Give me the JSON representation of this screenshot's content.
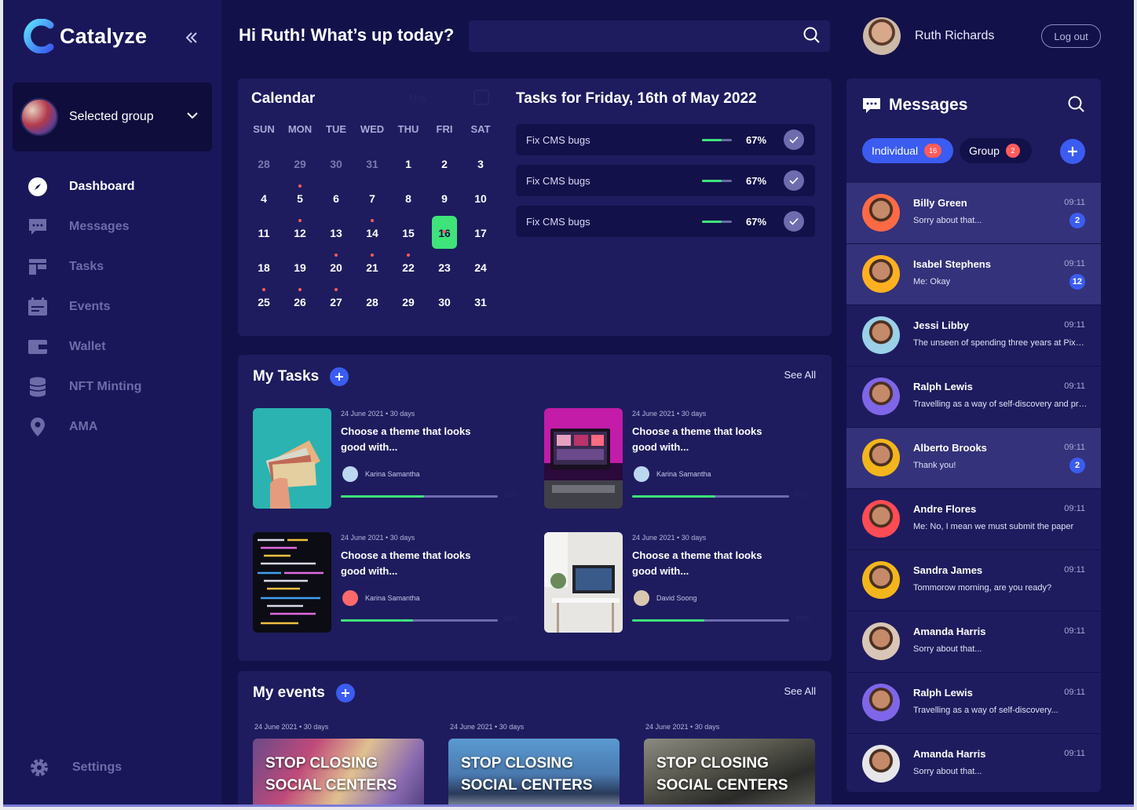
{
  "app": {
    "name": "Catalyze"
  },
  "sidebar": {
    "group_label": "Selected group",
    "items": [
      {
        "label": "Dashboard",
        "icon": "compass-icon",
        "active": true
      },
      {
        "label": "Messages",
        "icon": "chat-icon",
        "active": false
      },
      {
        "label": "Tasks",
        "icon": "tasks-icon",
        "active": false
      },
      {
        "label": "Events",
        "icon": "events-icon",
        "active": false
      },
      {
        "label": "Wallet",
        "icon": "wallet-icon",
        "active": false
      },
      {
        "label": "NFT Minting",
        "icon": "coins-icon",
        "active": false
      },
      {
        "label": "AMA",
        "icon": "location-icon",
        "active": false
      }
    ],
    "settings_label": "Settings"
  },
  "header": {
    "greeting": "Hi Ruth! What’s up today?",
    "search_placeholder": "",
    "user_name": "Ruth Richards",
    "logout_label": "Log out"
  },
  "calendar": {
    "title": "Calendar",
    "month": "May",
    "weekdays": [
      "SUN",
      "MON",
      "TUE",
      "WED",
      "THU",
      "FRI",
      "SAT"
    ],
    "weeks": [
      [
        {
          "d": "28",
          "m": true
        },
        {
          "d": "29",
          "m": true
        },
        {
          "d": "30",
          "m": true
        },
        {
          "d": "31",
          "m": true
        },
        {
          "d": "1"
        },
        {
          "d": "2"
        },
        {
          "d": "3"
        }
      ],
      [
        {
          "d": "4"
        },
        {
          "d": "5",
          "dot": true
        },
        {
          "d": "6"
        },
        {
          "d": "7"
        },
        {
          "d": "8"
        },
        {
          "d": "9"
        },
        {
          "d": "10"
        }
      ],
      [
        {
          "d": "11"
        },
        {
          "d": "12",
          "dot": true
        },
        {
          "d": "13"
        },
        {
          "d": "14",
          "dot": true
        },
        {
          "d": "15"
        },
        {
          "d": "16",
          "today": true,
          "dot": true
        },
        {
          "d": "17"
        }
      ],
      [
        {
          "d": "18"
        },
        {
          "d": "19"
        },
        {
          "d": "20",
          "dot": true
        },
        {
          "d": "21",
          "dot": true
        },
        {
          "d": "22",
          "dot": true
        },
        {
          "d": "23"
        },
        {
          "d": "24"
        }
      ],
      [
        {
          "d": "25",
          "dot": true
        },
        {
          "d": "26",
          "dot": true
        },
        {
          "d": "27",
          "dot": true
        },
        {
          "d": "28"
        },
        {
          "d": "29"
        },
        {
          "d": "30"
        },
        {
          "d": "31"
        }
      ]
    ]
  },
  "daily_tasks": {
    "title": "Tasks for Friday, 16th of May 2022",
    "items": [
      {
        "name": "Fix CMS bugs",
        "percent": "67%",
        "progress": 0.67
      },
      {
        "name": "Fix CMS bugs",
        "percent": "67%",
        "progress": 0.67
      },
      {
        "name": "Fix CMS bugs",
        "percent": "67%",
        "progress": 0.67
      }
    ]
  },
  "my_tasks": {
    "title": "My Tasks",
    "see_all": "See All",
    "items": [
      {
        "meta": "24 June 2021 • 30 days",
        "title": "Choose a theme that looks good with...",
        "assignee": "Karina Samantha",
        "progress": 0.53,
        "percent": "53%"
      },
      {
        "meta": "24 June 2021 • 30 days",
        "title": "Choose a theme that looks good with...",
        "assignee": "Karina Samantha",
        "progress": 0.53,
        "percent": "53%"
      },
      {
        "meta": "24 June 2021 • 30 days",
        "title": "Choose a theme that looks good with...",
        "assignee": "Karina Samantha",
        "progress": 0.46,
        "percent": "46%"
      },
      {
        "meta": "24 June 2021 • 30 days",
        "title": "Choose a theme that looks good with...",
        "assignee": "David Soong",
        "progress": 0.46,
        "percent": "46%"
      }
    ]
  },
  "my_events": {
    "title": "My events",
    "see_all": "See All",
    "items": [
      {
        "meta": "24 June 2021 • 30 days",
        "title_line1": "STOP CLOSING",
        "title_line2": "SOCIAL CENTERS"
      },
      {
        "meta": "24 June 2021 • 30 days",
        "title_line1": "STOP CLOSING",
        "title_line2": "SOCIAL CENTERS"
      },
      {
        "meta": "24 June 2021 • 30 days",
        "title_line1": "STOP CLOSING",
        "title_line2": "SOCIAL CENTERS"
      }
    ]
  },
  "messages": {
    "title": "Messages",
    "tabs": [
      {
        "label": "Individual",
        "count": "16"
      },
      {
        "label": "Group",
        "count": "2"
      }
    ],
    "items": [
      {
        "name": "Billy Green",
        "preview": "Sorry about that...",
        "time": "09:11",
        "badge": "2",
        "highlight": true,
        "avatar_bg": "#ff6a45"
      },
      {
        "name": "Isabel Stephens",
        "preview": "Me: Okay",
        "time": "09:11",
        "badge": "12",
        "highlight": true,
        "avatar_bg": "#ffb020"
      },
      {
        "name": "Jessi Libby",
        "preview": "The unseen of spending three years at Pixelgrade",
        "time": "09:11",
        "badge": "",
        "highlight": false,
        "avatar_bg": "#9ad0e8"
      },
      {
        "name": "Ralph Lewis",
        "preview": "Travelling as a way of self-discovery and progress",
        "time": "09:11",
        "badge": "",
        "highlight": false,
        "avatar_bg": "#7f66e8"
      },
      {
        "name": "Alberto Brooks",
        "preview": "Thank you!",
        "time": "09:11",
        "badge": "2",
        "highlight": true,
        "avatar_bg": "#f2b61c"
      },
      {
        "name": "Andre Flores",
        "preview": "Me: No, I mean we must submit the paper",
        "time": "09:11",
        "badge": "",
        "highlight": false,
        "avatar_bg": "#ff4b55"
      },
      {
        "name": "Sandra James",
        "preview": "Tommorow morning, are you ready?",
        "time": "09:11",
        "badge": "",
        "highlight": false,
        "avatar_bg": "#f2b61c"
      },
      {
        "name": "Amanda Harris",
        "preview": "Sorry about that...",
        "time": "09:11",
        "badge": "",
        "highlight": false,
        "avatar_bg": "#d9c6b6"
      },
      {
        "name": "Ralph Lewis",
        "preview": "Travelling as a way of self-discovery...",
        "time": "09:11",
        "badge": "",
        "highlight": false,
        "avatar_bg": "#7f66e8"
      },
      {
        "name": "Amanda Harris",
        "preview": "Sorry about that...",
        "time": "09:11",
        "badge": "",
        "highlight": false,
        "avatar_bg": "#e6e6ea"
      }
    ]
  },
  "colors": {
    "background": "#13114a",
    "panel": "#1e1c5e",
    "sidebar": "#19175a",
    "accent": "#3b5cf0",
    "success": "#3ee37a",
    "alert": "#ff5b5b"
  }
}
